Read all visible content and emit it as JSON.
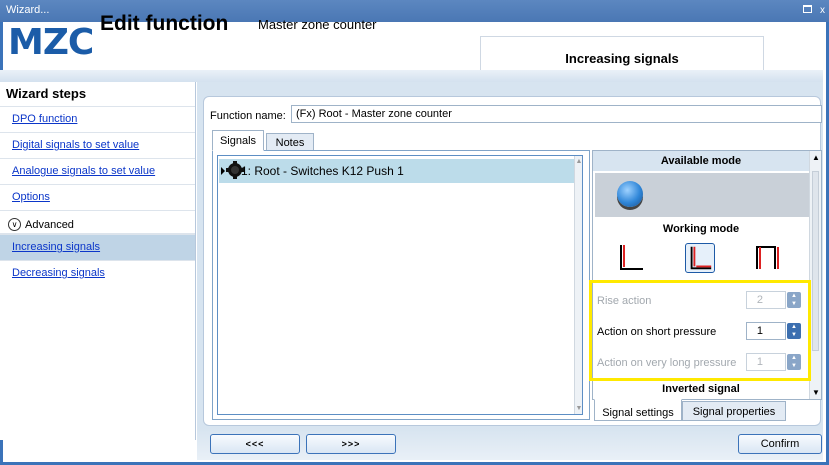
{
  "window": {
    "title": "Wizard..."
  },
  "header": {
    "logo": "MZC",
    "title": "Edit function",
    "subtitle": "Master zone counter",
    "section_tab": "Increasing signals"
  },
  "sidebar": {
    "title": "Wizard steps",
    "items": [
      {
        "label": "DPO function",
        "active": false
      },
      {
        "label": "Digital signals to set value",
        "active": false
      },
      {
        "label": "Analogue signals to set value",
        "active": false
      },
      {
        "label": "Options",
        "active": false
      },
      {
        "label": "Advanced",
        "active": false
      },
      {
        "label": "Increasing signals",
        "active": true
      },
      {
        "label": "Decreasing signals",
        "active": false
      }
    ]
  },
  "function_name": {
    "label": "Function name:",
    "value": "(Fx) Root - Master zone counter"
  },
  "tabs": [
    {
      "label": "Signals",
      "selected": true
    },
    {
      "label": "Notes",
      "selected": false
    }
  ],
  "signals": [
    {
      "label": "1: Root - Switches K12 Push 1"
    }
  ],
  "properties": {
    "available_mode_title": "Available mode",
    "working_mode_title": "Working mode",
    "params": [
      {
        "label": "Rise action",
        "value": "2",
        "enabled": false
      },
      {
        "label": "Action on short pressure",
        "value": "1",
        "enabled": true
      },
      {
        "label": "Action on very long pressure",
        "value": "1",
        "enabled": false
      }
    ],
    "inverted_signal_title": "Inverted signal",
    "bottom_tabs": [
      {
        "label": "Signal settings",
        "selected": true
      },
      {
        "label": "Signal properties",
        "selected": false
      }
    ]
  },
  "footer": {
    "prev_label": "<<<",
    "next_label": ">>>",
    "confirm_label": "Confirm"
  },
  "colors": {
    "accent": "#3b73b9",
    "highlight": "#ffe900",
    "active_row": "#bfd4e6",
    "signal_row": "#bcdcea"
  }
}
